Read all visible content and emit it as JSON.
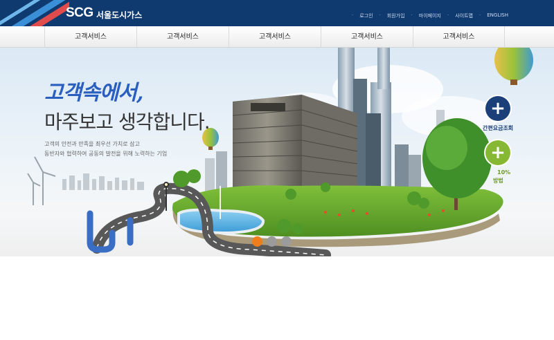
{
  "header": {
    "brand": "SCG",
    "brand_kr": "서울도시가스",
    "util_links": [
      "로그인",
      "회원가입",
      "마이페이지",
      "사이트맵",
      "ENGLISH"
    ]
  },
  "nav": {
    "items": [
      "고객서비스",
      "고객서비스",
      "고객서비스",
      "고객서비스",
      "고객서비스"
    ]
  },
  "hero": {
    "headline_script": "고객속에서,",
    "headline_main": "마주보고 생각합니다.",
    "tagline_line1": "고객의 안전과 만족을 최우선 가치로 삼고",
    "tagline_line2": "동반자와 협력하여 공동의 발전을 위해 노력하는 기업",
    "quick1_label": "간편요금조회",
    "quick2_label_line1": "10%",
    "quick2_label_line2": "방법",
    "slides": 3,
    "active_slide": 1
  },
  "colors": {
    "header_bg": "#0f3a70",
    "accent_orange": "#ee7d1b",
    "navy_button": "#1b3f78",
    "green_button": "#86b834"
  }
}
